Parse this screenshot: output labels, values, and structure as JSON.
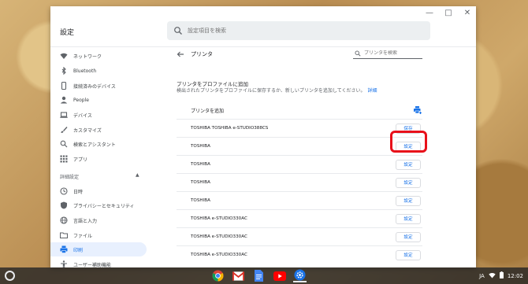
{
  "window": {
    "title": "設定",
    "search_placeholder": "設定項目を検索"
  },
  "sidebar": {
    "items": [
      {
        "label": "ネットワーク",
        "icon": "wifi-icon"
      },
      {
        "label": "Bluetooth",
        "icon": "bluetooth-icon"
      },
      {
        "label": "接続済みのデバイス",
        "icon": "phone-icon"
      },
      {
        "label": "People",
        "icon": "person-icon"
      },
      {
        "label": "デバイス",
        "icon": "laptop-icon"
      },
      {
        "label": "カスタマイズ",
        "icon": "brush-icon"
      },
      {
        "label": "検索とアシスタント",
        "icon": "search-icon"
      },
      {
        "label": "アプリ",
        "icon": "apps-grid-icon"
      }
    ],
    "advanced_label": "詳細設定",
    "advanced_items": [
      {
        "label": "日時",
        "icon": "clock-icon"
      },
      {
        "label": "プライバシーとセキュリティ",
        "icon": "shield-icon"
      },
      {
        "label": "言語と入力",
        "icon": "globe-icon"
      },
      {
        "label": "ファイル",
        "icon": "folder-icon"
      },
      {
        "label": "印刷",
        "icon": "printer-icon",
        "active": true
      },
      {
        "label": "ユーザー補助機能",
        "icon": "accessibility-icon"
      }
    ]
  },
  "main": {
    "title": "プリンタ",
    "printer_search_placeholder": "プリンタを検索",
    "profile_title": "プリンタをプロファイルに追加",
    "profile_desc": "検出されたプリンタをプロファイルに保存するか、新しいプリンタを追加してください。",
    "profile_link": "詳細",
    "add_printer_label": "プリンタを追加",
    "printers": [
      {
        "name": "TOSHIBA TOSHIBA e-STUDIO388CS",
        "button": "保存"
      },
      {
        "name": "TOSHIBA",
        "button": "設定"
      },
      {
        "name": "TOSHIBA",
        "button": "設定"
      },
      {
        "name": "TOSHIBA",
        "button": "設定"
      },
      {
        "name": "TOSHIBA",
        "button": "設定"
      },
      {
        "name": "TOSHIBA e-STUDIO330AC",
        "button": "設定"
      },
      {
        "name": "TOSHIBA e-STUDIO330AC",
        "button": "設定"
      },
      {
        "name": "TOSHIBA e-STUDIO330AC",
        "button": "設定"
      }
    ]
  },
  "shelf": {
    "apps": [
      "chrome-icon",
      "gmail-icon",
      "docs-icon",
      "youtube-icon",
      "settings-app-icon"
    ],
    "ime": "JA",
    "time": "12:02"
  },
  "colors": {
    "accent": "#1a73e8",
    "highlight": "#e8101a",
    "active_nav_bg": "#e8f0fe"
  }
}
